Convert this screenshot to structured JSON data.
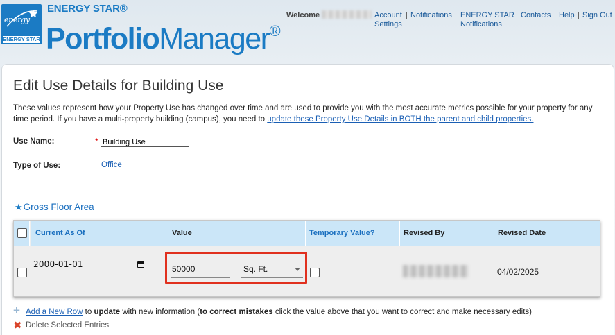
{
  "brand": {
    "logo_script": "energy",
    "logo_bar": "ENERGY STAR",
    "top": "ENERGY STAR®",
    "main_bold": "Portfolio",
    "main_regular": "Manager",
    "registered": "®"
  },
  "topnav": {
    "welcome": "Welcome",
    "links": {
      "account_settings_1": "Account",
      "account_settings_2": "Settings",
      "notifications": "Notifications",
      "es_notifications_1": "ENERGY STAR",
      "es_notifications_2": "Notifications",
      "contacts": "Contacts",
      "help": "Help",
      "sign_out": "Sign Out"
    },
    "separator": "|"
  },
  "page": {
    "title": "Edit Use Details for Building Use",
    "intro_text": "These values represent how your Property Use has changed over time and are used to provide you with the most accurate metrics possible for your property for any time period. If you have a multi-property building (campus), you need to ",
    "intro_link": "update these Property Use Details in BOTH the parent and child properties."
  },
  "form": {
    "use_name_label": "Use Name:",
    "required_marker": "*",
    "use_name_value": "Building Use",
    "type_of_use_label": "Type of Use:",
    "type_of_use_value": "Office"
  },
  "section": {
    "star": "★",
    "title": "Gross Floor Area"
  },
  "table": {
    "headers": {
      "current_as_of": "Current As Of",
      "value": "Value",
      "temporary_value": "Temporary Value?",
      "revised_by": "Revised By",
      "revised_date": "Revised Date"
    },
    "row": {
      "current_as_of": "2000-01-01",
      "value": "50000",
      "unit": "Sq. Ft.",
      "revised_date": "04/02/2025"
    }
  },
  "actions": {
    "add_link": "Add a New Row",
    "add_text_1": " to ",
    "add_bold_1": "update",
    "add_text_2": " with new information (",
    "add_bold_2": "to correct mistakes",
    "add_text_3": " click the value above that you want to correct and make necessary edits)",
    "delete_label": "Delete Selected Entries"
  },
  "colors": {
    "brand_blue": "#1b7bc4",
    "link_blue": "#1a5fb4",
    "header_cell": "#cbe6f8",
    "highlight_red": "#e0301e"
  }
}
